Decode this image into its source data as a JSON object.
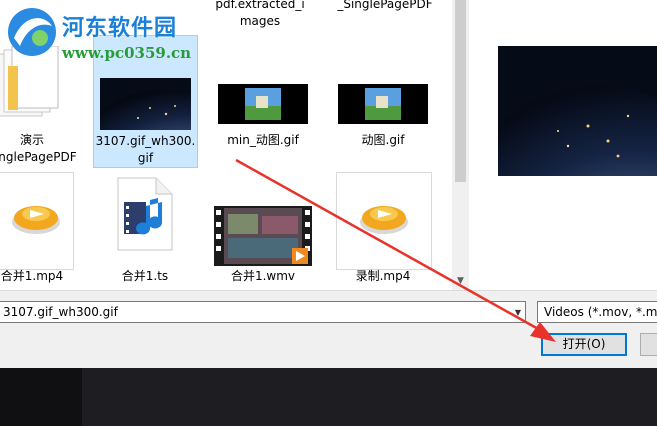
{
  "watermark": {
    "title": "河东软件园",
    "url": "www.pc0359.cn"
  },
  "files": {
    "top_labels": [
      "pdf.extracted_i",
      "mages",
      "_SinglePagePDF"
    ],
    "row1": [
      {
        "line1": "演示",
        "line2": "SinglePagePDF",
        "icon": "document-stack-icon"
      },
      {
        "line1": "3107.gif_wh300.",
        "line2": "gif",
        "icon": "earth-night-thumbnail",
        "selected": true
      },
      {
        "line1": "min_动图.gif",
        "line2": "",
        "icon": "landscape-video-thumbnail"
      },
      {
        "line1": "动图.gif",
        "line2": "",
        "icon": "landscape-video-thumbnail"
      }
    ],
    "row2": [
      {
        "line1": "合并1.mp4",
        "icon": "media-player-icon"
      },
      {
        "line1": "合并1.ts",
        "icon": "video-file-icon"
      },
      {
        "line1": "合并1.wmv",
        "icon": "film-strip-thumbnail"
      },
      {
        "line1": "录制.mp4",
        "icon": "media-player-icon"
      }
    ]
  },
  "scrollbar": {
    "up": "▲",
    "down": "▼"
  },
  "dialog": {
    "filename": "3107.gif_wh300.gif",
    "dropdown_glyph": "▼",
    "filetype": "Videos (*.mov, *.mp",
    "open_label": "打开(O)"
  },
  "colors": {
    "accent": "#0078d7",
    "selection": "#cce8ff",
    "arrow": "#e8332a"
  }
}
